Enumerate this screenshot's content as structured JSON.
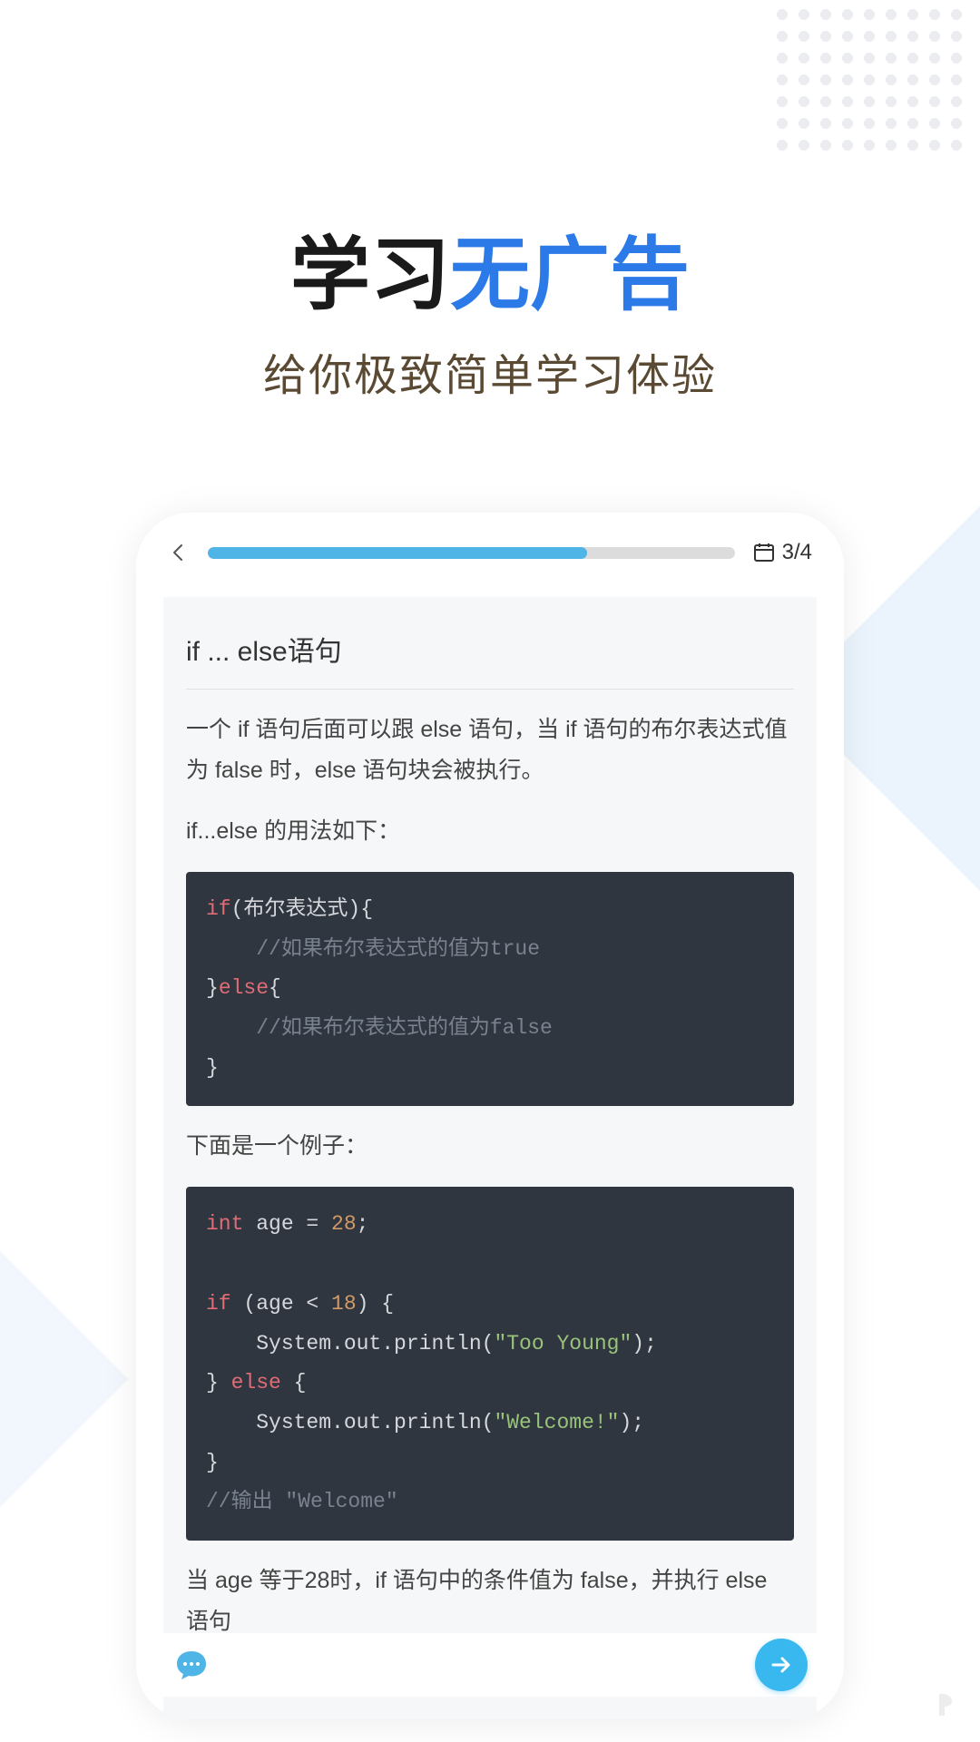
{
  "hero": {
    "title_black": "学习",
    "title_blue": "无广告",
    "subtitle": "给你极致简单学习体验"
  },
  "topbar": {
    "progress_percent": 72,
    "page_label": "3/4"
  },
  "lesson": {
    "title": "if ... else语句",
    "p1": "一个 if 语句后面可以跟 else 语句，当 if 语句的布尔表达式值为 false 时，else 语句块会被执行。",
    "p2": "if...else 的用法如下：",
    "code1": {
      "line1_kw": "if",
      "line1_rest": "(布尔表达式){",
      "line2_comment": "    //如果布尔表达式的值为true",
      "line3_brace": "}",
      "line3_kw": "else",
      "line3_rest": "{",
      "line4_comment": "    //如果布尔表达式的值为false",
      "line5": "}"
    },
    "p3": "下面是一个例子：",
    "code2": {
      "l1_ty": "int",
      "l1_rest": " age = ",
      "l1_num": "28",
      "l1_end": ";",
      "l3_kw": "if",
      "l3_rest": " (age < ",
      "l3_num": "18",
      "l3_end": ") {",
      "l4_indent": "    System.out.println(",
      "l4_str": "\"Too Young\"",
      "l4_end": ");",
      "l5_brace": "} ",
      "l5_kw": "else",
      "l5_rest": " {",
      "l6_indent": "    System.out.println(",
      "l6_str": "\"Welcome!\"",
      "l6_end": ");",
      "l7": "}",
      "l8_comment": "//输出 \"Welcome\""
    },
    "p4": "当 age 等于28时，if 语句中的条件值为 false，并执行 else 语句"
  },
  "colors": {
    "accent": "#2c7ae7",
    "code_bg": "#2f3640",
    "progress": "#4fb4e6"
  }
}
